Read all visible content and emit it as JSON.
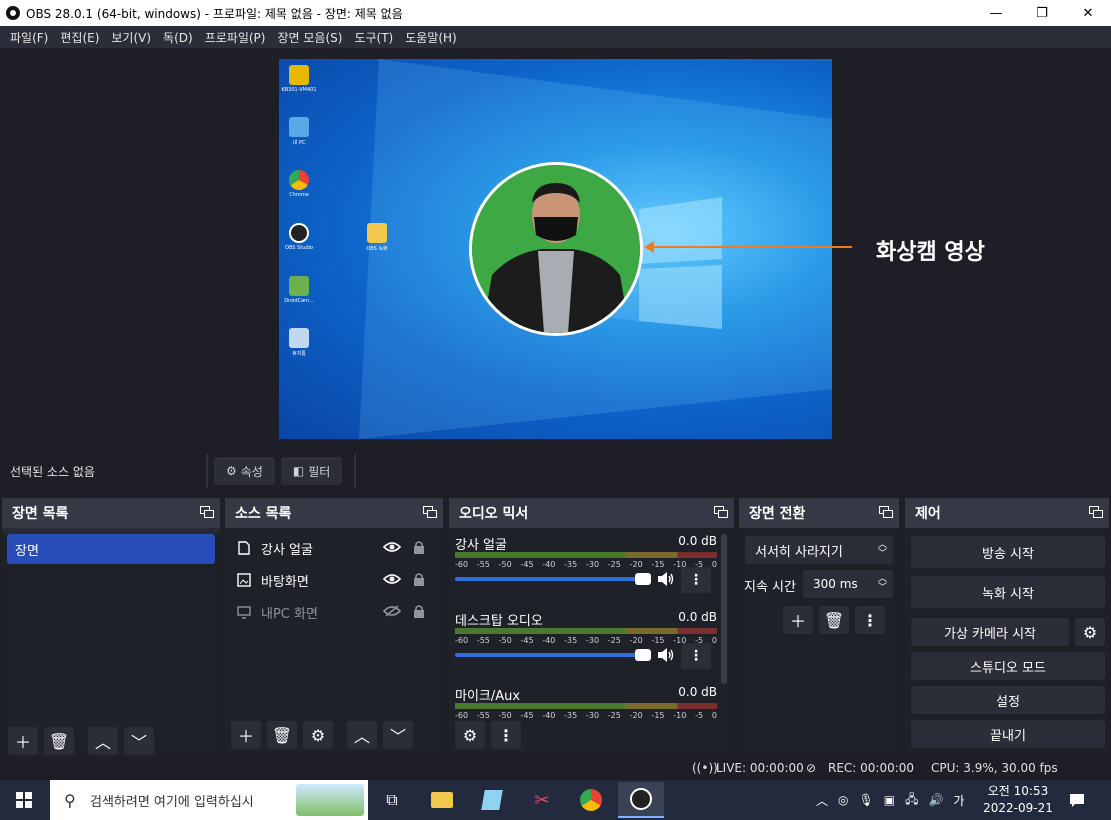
{
  "window": {
    "title": "OBS 28.0.1 (64-bit, windows) - 프로파일: 제목 없음 - 장면: 제목 없음",
    "minimize": "—",
    "maximize": "❐",
    "close": "✕"
  },
  "menu": [
    "파일(F)",
    "편집(E)",
    "보기(V)",
    "독(D)",
    "프로파일(P)",
    "장면 모음(S)",
    "도구(T)",
    "도움말(H)"
  ],
  "preview": {
    "desktop_icons": [
      {
        "label": "KB301-VM401",
        "color": "#e6b800"
      },
      {
        "label": "내 PC",
        "color": "#5aa9e6"
      },
      {
        "label": "Chrome",
        "color": "#e94235"
      },
      {
        "label": "OBS Studio",
        "color": "#222222"
      },
      {
        "label": "DroidCam...",
        "color": "#6ab04c"
      },
      {
        "label": "휴지통",
        "color": "#c0d8f0"
      },
      {
        "label": "OBS 녹화",
        "color": "#f2c94c"
      }
    ],
    "annotation": "화상캠 영상"
  },
  "source_toolbar": {
    "no_source": "선택된 소스 없음",
    "properties": "속성",
    "filters": "필터"
  },
  "scenes": {
    "title": "장면 목록",
    "items": [
      "장면"
    ]
  },
  "sources": {
    "title": "소스 목록",
    "items": [
      {
        "label": "강사 얼굴",
        "visible": true
      },
      {
        "label": "바탕화면",
        "visible": true
      },
      {
        "label": "내PC 화면",
        "visible": false
      }
    ]
  },
  "mixer": {
    "title": "오디오 믹서",
    "ticks": [
      "-60",
      "-55",
      "-50",
      "-45",
      "-40",
      "-35",
      "-30",
      "-25",
      "-20",
      "-15",
      "-10",
      "-5",
      "0"
    ],
    "channels": [
      {
        "name": "강사 얼굴",
        "db": "0.0 dB"
      },
      {
        "name": "데스크탑 오디오",
        "db": "0.0 dB"
      },
      {
        "name": "마이크/Aux",
        "db": "0.0 dB"
      }
    ]
  },
  "transitions": {
    "title": "장면 전환",
    "selected": "서서히 사라지기",
    "duration_label": "지속 시간",
    "duration_value": "300 ms"
  },
  "controls": {
    "title": "제어",
    "start_streaming": "방송 시작",
    "start_recording": "녹화 시작",
    "virtual_camera": "가상 카메라 시작",
    "studio_mode": "스튜디오 모드",
    "settings": "설정",
    "exit": "끝내기"
  },
  "status": {
    "live": "LIVE: 00:00:00",
    "rec": "REC: 00:00:00",
    "cpu": "CPU: 3.9%, 30.00 fps"
  },
  "taskbar": {
    "search_placeholder": "검색하려면 여기에 입력하십시",
    "ime": "가",
    "time": "오전 10:53",
    "date": "2022-09-21"
  },
  "colors": {
    "accent": "#284cb8",
    "annotation_arrow": "#f07a1e",
    "slider": "#2f6fdb"
  }
}
